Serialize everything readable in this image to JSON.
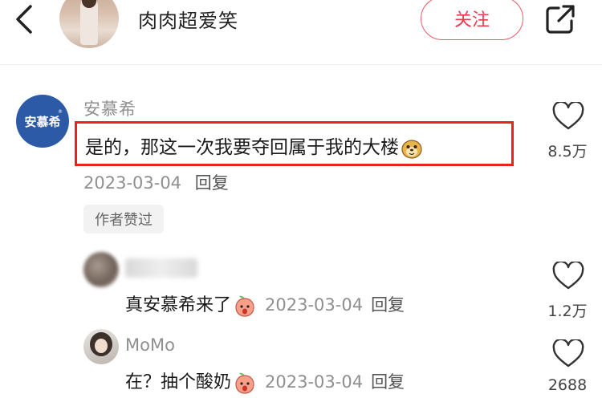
{
  "header": {
    "author_name": "肉肉超爱笑",
    "follow_label": "关注"
  },
  "comment": {
    "avatar_text": "安慕希",
    "avatar_mark": "®",
    "user": "安慕希",
    "text": "是的，那这一次我要夺回属于我的大楼",
    "date": "2023-03-04",
    "reply_label": "回复",
    "likes": "8.5万",
    "badge": "作者赞过"
  },
  "replies": [
    {
      "user": "",
      "text": "真安慕希来了",
      "date": "2023-03-04",
      "reply_label": "回复",
      "likes": "1.2万"
    },
    {
      "user": "MoMo",
      "text": "在？抽个酸奶",
      "date": "2023-03-04",
      "reply_label": "回复",
      "likes": "2688"
    }
  ],
  "colors": {
    "follow_red": "#ee3a4f",
    "highlight_red": "#e8221c",
    "brand_blue": "#2d5aa6",
    "meta_gray": "#8f8f8f"
  },
  "icons": [
    "back-arrow-icon",
    "share-icon",
    "heart-icon",
    "meerkat-emoji-icon",
    "peach-emoji-icon"
  ]
}
